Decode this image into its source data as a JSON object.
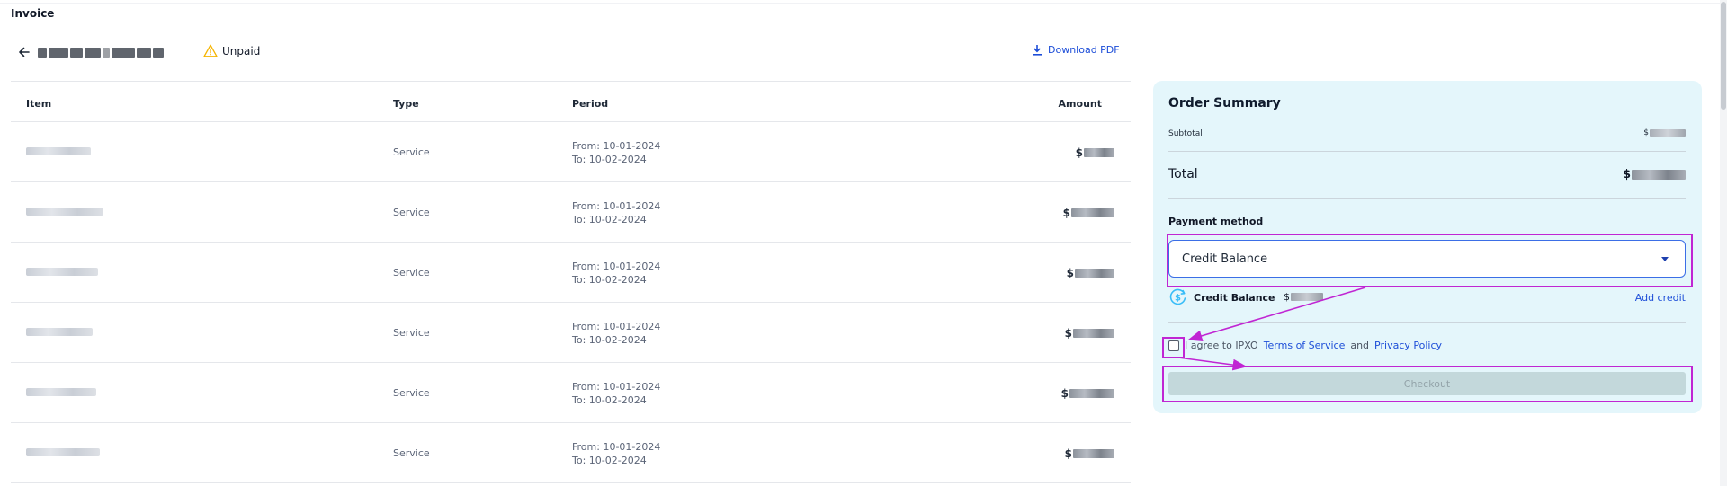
{
  "page": {
    "title": "Invoice"
  },
  "header": {
    "status": "Unpaid",
    "download_label": "Download PDF"
  },
  "table": {
    "columns": [
      "Item",
      "Type",
      "Period",
      "Amount"
    ],
    "rows": [
      {
        "type": "Service",
        "period_from": "From: 10-01-2024",
        "period_to": "To: 10-02-2024",
        "currency": "$"
      },
      {
        "type": "Service",
        "period_from": "From: 10-01-2024",
        "period_to": "To: 10-02-2024",
        "currency": "$"
      },
      {
        "type": "Service",
        "period_from": "From: 10-01-2024",
        "period_to": "To: 10-02-2024",
        "currency": "$"
      },
      {
        "type": "Service",
        "period_from": "From: 10-01-2024",
        "period_to": "To: 10-02-2024",
        "currency": "$"
      },
      {
        "type": "Service",
        "period_from": "From: 10-01-2024",
        "period_to": "To: 10-02-2024",
        "currency": "$"
      },
      {
        "type": "Service",
        "period_from": "From: 10-01-2024",
        "period_to": "To: 10-02-2024",
        "currency": "$"
      }
    ]
  },
  "summary": {
    "title": "Order Summary",
    "subtotal_label": "Subtotal",
    "total_label": "Total",
    "currency": "$",
    "payment_method_label": "Payment method",
    "payment_method_value": "Credit Balance",
    "credit_balance_label": "Credit Balance",
    "add_credit_label": "Add credit",
    "agree_prefix": "I agree to IPXO",
    "terms_label": "Terms of Service",
    "and_text": "and",
    "privacy_label": "Privacy Policy",
    "checkout_label": "Checkout"
  },
  "colors": {
    "accent": "#1d4ed8",
    "panel_bg": "#e4f6fb",
    "annotation": "#c026d3",
    "warning": "#f5b400",
    "checkout_disabled": "#c3d8db"
  }
}
